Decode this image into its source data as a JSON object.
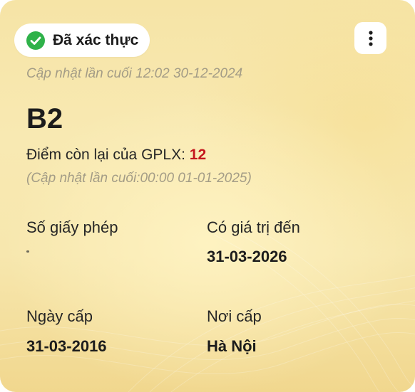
{
  "status_badge": {
    "label": "Đã xác thực",
    "icon": "check-circle-icon",
    "color": "#2fb24a"
  },
  "menu": {
    "icon": "more-vertical-icon"
  },
  "last_updated": "Cập nhật lần cuối 12:02 30-12-2024",
  "license_class": "B2",
  "points": {
    "label": "Điểm còn lại của GPLX:",
    "value": "12",
    "value_color": "#c4161c",
    "updated": "(Cập nhật lần cuối:00:00 01-01-2025)"
  },
  "fields": {
    "license_number": {
      "label": "Số giấy phép",
      "value": ""
    },
    "valid_until": {
      "label": "Có giá trị đến",
      "value": "31-03-2026"
    },
    "issue_date": {
      "label": "Ngày cấp",
      "value": "31-03-2016"
    },
    "issue_place": {
      "label": "Nơi cấp",
      "value": "Hà Nội"
    }
  }
}
